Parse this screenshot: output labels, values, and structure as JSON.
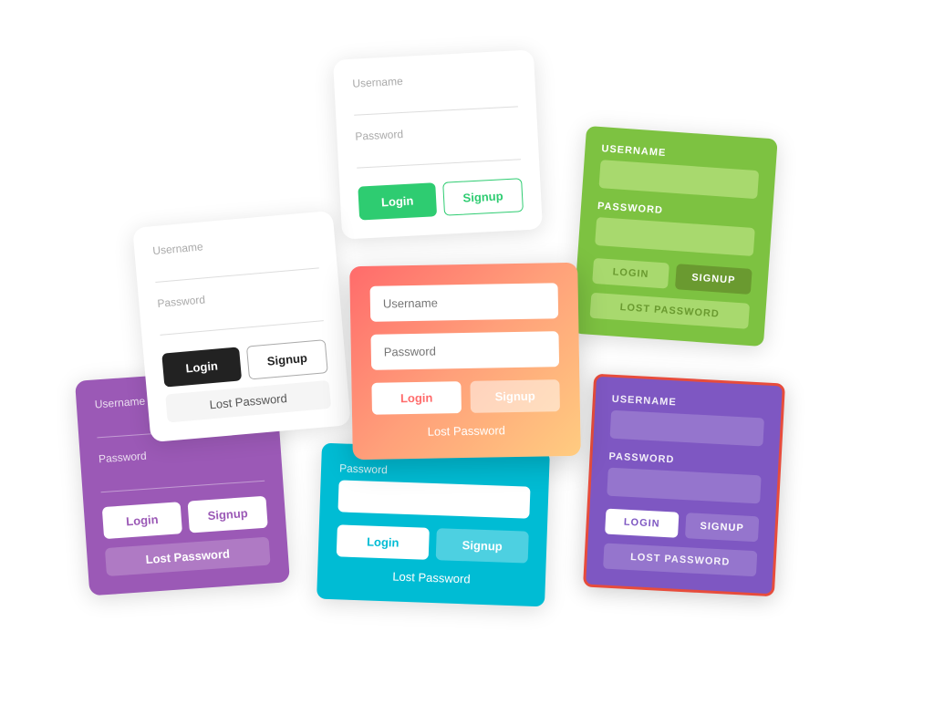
{
  "cards": {
    "white_top": {
      "username_label": "Username",
      "password_label": "Password",
      "login_btn": "Login",
      "signup_btn": "Signup"
    },
    "bw": {
      "username_label": "Username",
      "password_label": "Password",
      "login_btn": "Login",
      "signup_btn": "Signup",
      "lost_password": "Lost Password"
    },
    "green": {
      "username_label": "USERNAME",
      "password_label": "PASSWORD",
      "login_btn": "LOGIN",
      "signup_btn": "SIGNUP",
      "lost_password": "LOST PASSWORD"
    },
    "gradient": {
      "username_placeholder": "Username",
      "password_placeholder": "Password",
      "login_btn": "Login",
      "signup_btn": "Signup",
      "lost_password": "Lost Password"
    },
    "purple": {
      "username_label": "Username",
      "password_label": "Password",
      "login_btn": "Login",
      "signup_btn": "Signup",
      "lost_password": "Lost Password"
    },
    "cyan": {
      "password_label": "Password",
      "login_btn": "Login",
      "signup_btn": "Signup",
      "lost_password": "Lost Password"
    },
    "purple_dark": {
      "username_label": "USERNAME",
      "password_label": "PASSWORD",
      "login_btn": "LOGIN",
      "signup_btn": "SIGNUP",
      "lost_password": "LOST PASSWORD"
    }
  }
}
